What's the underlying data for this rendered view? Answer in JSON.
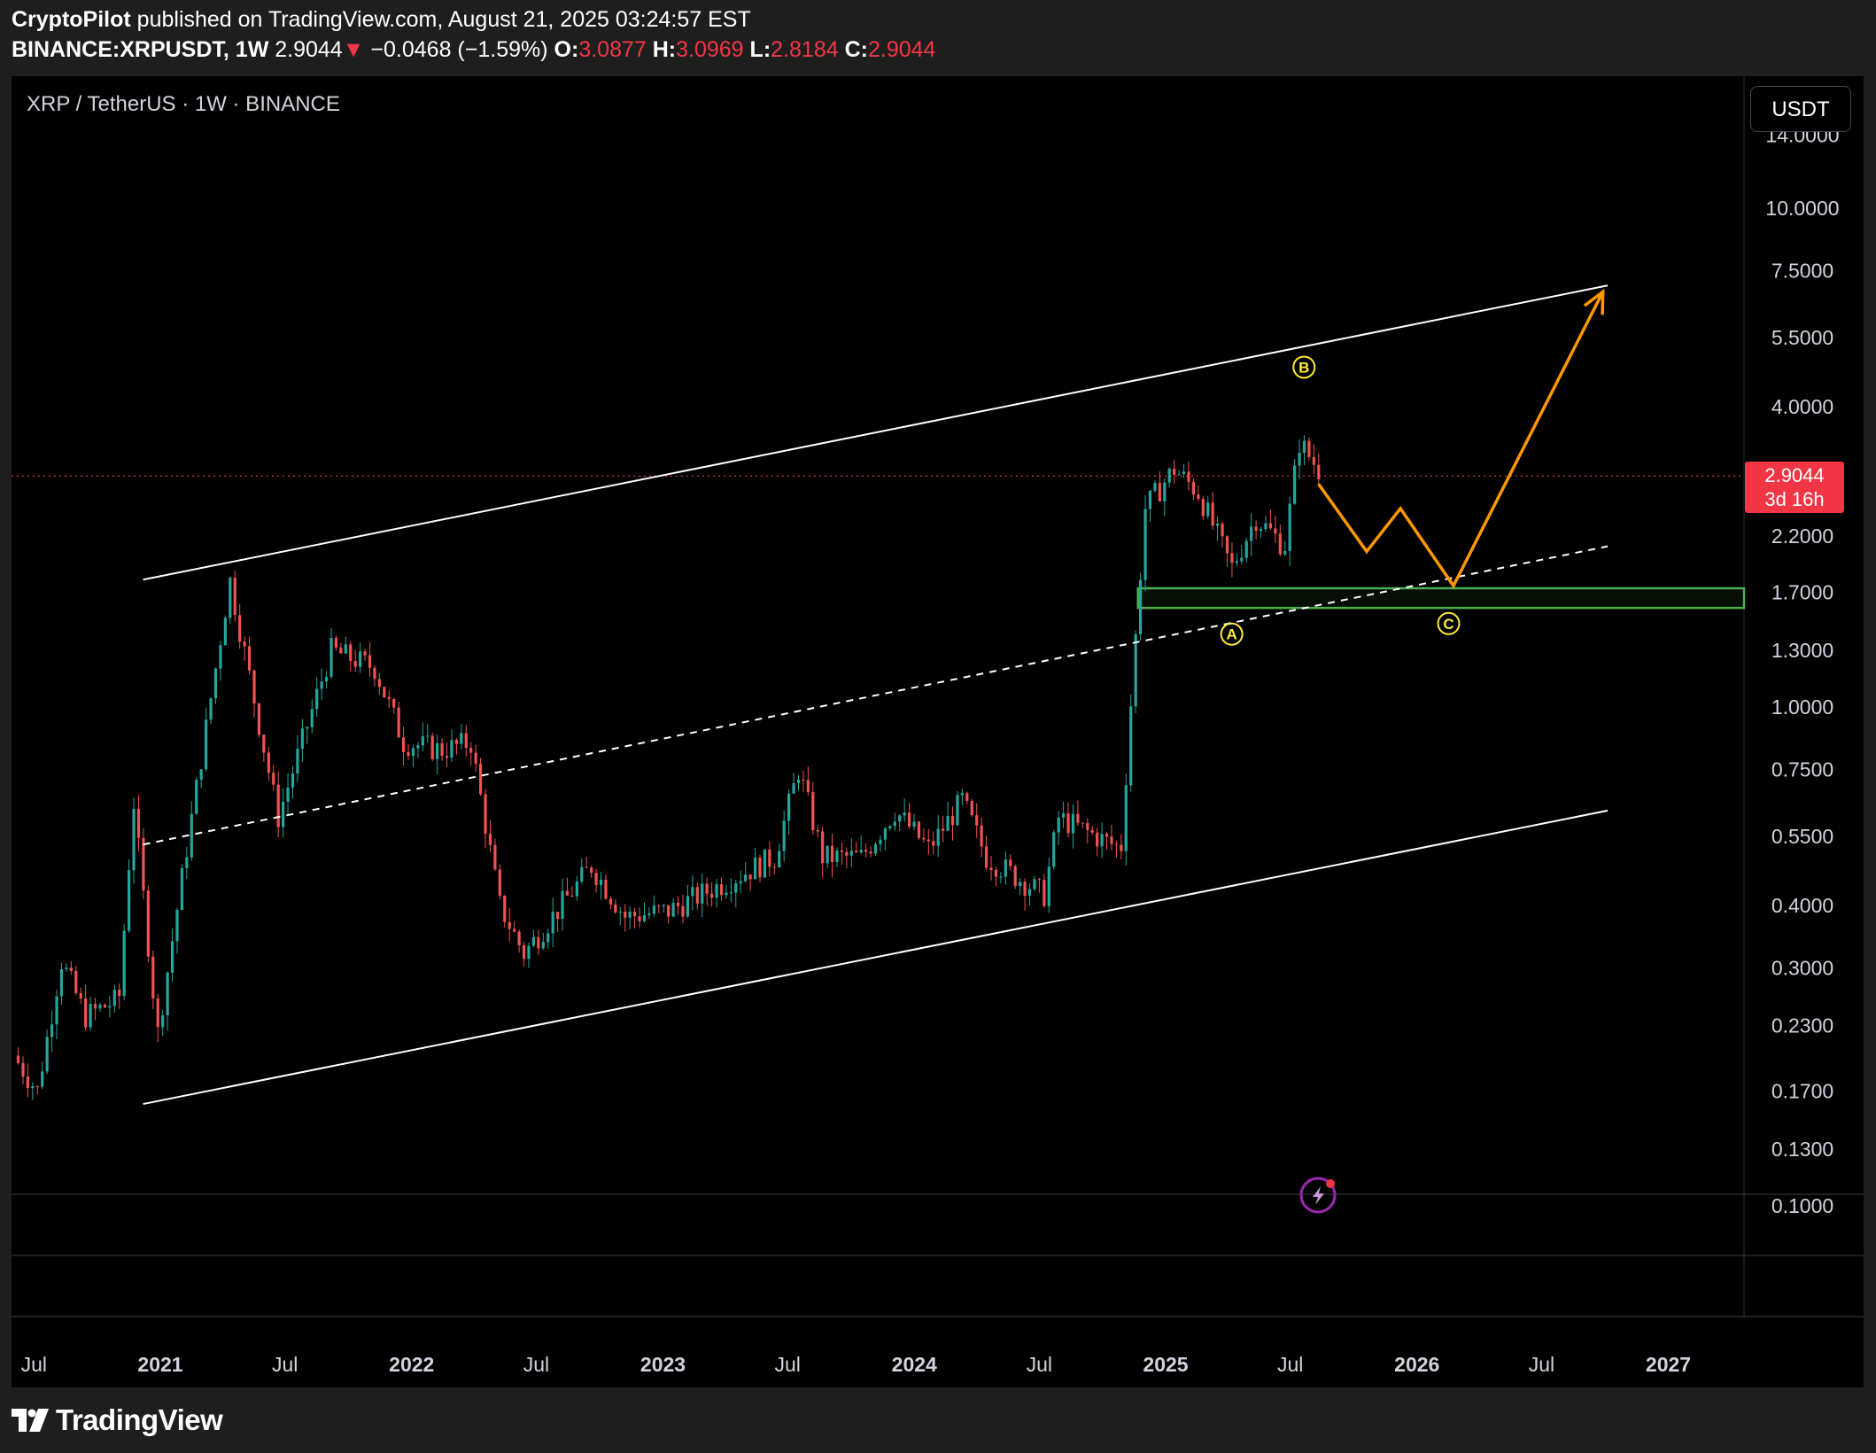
{
  "header": {
    "author": "CryptoPilot",
    "published_text": "published on TradingView.com, August 21, 2025 03:24:57 EST",
    "symbol": "BINANCE:XRPUSDT, 1W",
    "last_price": "2.9044",
    "down_arrow": "▼",
    "change": "−0.0468 (−1.59%)",
    "open_label": "O:",
    "open_value": "3.0877",
    "high_label": "H:",
    "high_value": "3.0969",
    "low_label": "L:",
    "low_value": "2.8184",
    "close_label": "C:",
    "close_value": "2.9044"
  },
  "chart": {
    "symbol_label": "XRP / TetherUS · 1W · BINANCE",
    "currency_button": "USDT",
    "price_badge": {
      "price": "2.9044",
      "countdown": "3d 16h"
    },
    "wave_labels": {
      "a": "A",
      "b": "B",
      "c": "C"
    }
  },
  "chart_data": {
    "type": "candlestick",
    "symbol": "BINANCE:XRPUSDT",
    "interval": "1W",
    "log_scale": true,
    "y_ticks": [
      "14.0000",
      "10.0000",
      "7.5000",
      "5.5000",
      "4.0000",
      "2.2000",
      "1.7000",
      "1.3000",
      "1.0000",
      "0.7500",
      "0.5500",
      "0.4000",
      "0.3000",
      "0.2300",
      "0.1700",
      "0.1300",
      "0.1000"
    ],
    "x_ticks": [
      "Jul",
      "2021",
      "Jul",
      "2022",
      "Jul",
      "2023",
      "Jul",
      "2024",
      "Jul",
      "2025",
      "Jul",
      "2026",
      "Jul",
      "2027"
    ],
    "x_tick_bold": [
      false,
      true,
      false,
      true,
      false,
      true,
      false,
      true,
      false,
      true,
      false,
      true,
      false,
      true
    ],
    "last_price": 2.9044,
    "price_path": [
      [
        "2020-06-01",
        0.2
      ],
      [
        "2020-07-06",
        0.17
      ],
      [
        "2020-08-10",
        0.31
      ],
      [
        "2020-09-14",
        0.24
      ],
      [
        "2020-11-02",
        0.26
      ],
      [
        "2020-11-23",
        0.65
      ],
      [
        "2020-12-28",
        0.22
      ],
      [
        "2021-02-01",
        0.45
      ],
      [
        "2021-04-12",
        1.8
      ],
      [
        "2021-06-21",
        0.6
      ],
      [
        "2021-09-06",
        1.3
      ],
      [
        "2021-11-08",
        1.2
      ],
      [
        "2021-12-20",
        0.85
      ],
      [
        "2022-02-14",
        0.82
      ],
      [
        "2022-03-28",
        0.85
      ],
      [
        "2022-05-09",
        0.4
      ],
      [
        "2022-06-13",
        0.32
      ],
      [
        "2022-09-19",
        0.48
      ],
      [
        "2022-11-07",
        0.38
      ],
      [
        "2023-01-09",
        0.39
      ],
      [
        "2023-06-12",
        0.5
      ],
      [
        "2023-07-17",
        0.75
      ],
      [
        "2023-08-21",
        0.5
      ],
      [
        "2023-10-16",
        0.5
      ],
      [
        "2023-12-04",
        0.62
      ],
      [
        "2024-01-22",
        0.52
      ],
      [
        "2024-03-11",
        0.65
      ],
      [
        "2024-04-15",
        0.5
      ],
      [
        "2024-07-08",
        0.42
      ],
      [
        "2024-07-29",
        0.6
      ],
      [
        "2024-10-28",
        0.52
      ],
      [
        "2024-11-11",
        1.0
      ],
      [
        "2024-12-02",
        2.5
      ],
      [
        "2025-01-13",
        3.0
      ],
      [
        "2025-02-17",
        2.7
      ],
      [
        "2025-04-07",
        1.9
      ],
      [
        "2025-05-12",
        2.4
      ],
      [
        "2025-06-23",
        2.1
      ],
      [
        "2025-07-14",
        3.4
      ],
      [
        "2025-08-18",
        2.9
      ]
    ],
    "channel_upper": [
      [
        "2020-12-07",
        1.8
      ],
      [
        "2026-10-05",
        7.0
      ]
    ],
    "channel_lower": [
      [
        "2020-12-07",
        0.16
      ],
      [
        "2026-10-05",
        0.62
      ]
    ],
    "channel_mid": [
      [
        "2020-12-07",
        0.53
      ],
      [
        "2026-10-05",
        2.1
      ]
    ],
    "support_zone": {
      "from": "2024-12-02",
      "to": "2027-01-01",
      "low": 1.58,
      "high": 1.73
    },
    "projection_path": [
      [
        "2025-08-11",
        2.8
      ],
      [
        "2025-10-20",
        2.05
      ],
      [
        "2025-12-08",
        2.5
      ],
      [
        "2026-02-23",
        1.75
      ],
      [
        "2026-09-28",
        6.8
      ]
    ],
    "wave_points": [
      {
        "label": "A",
        "date": "2025-04-07",
        "price": 1.4
      },
      {
        "label": "B",
        "date": "2025-07-21",
        "price": 4.8
      },
      {
        "label": "C",
        "date": "2026-02-16",
        "price": 1.47
      }
    ],
    "colors": {
      "up": "#26a69a",
      "down": "#ef5350",
      "channel": "#ffffff",
      "projection": "#ff9800",
      "zone": "#4caf50",
      "wave_label": "#ffeb3b",
      "price_line": "#f23645"
    }
  },
  "footer": {
    "brand": "TradingView"
  }
}
